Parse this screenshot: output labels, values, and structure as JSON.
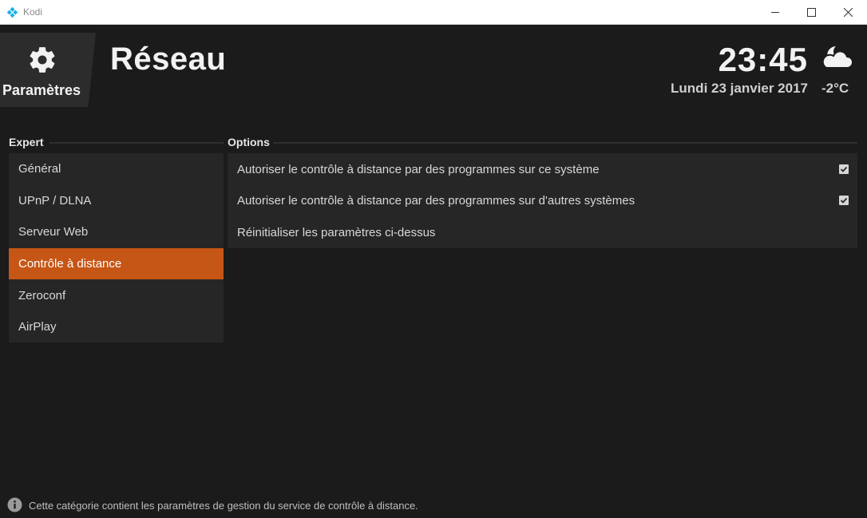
{
  "window": {
    "title": "Kodi",
    "minimize_icon": "minimize-icon",
    "maximize_icon": "maximize-icon",
    "close_icon": "close-icon"
  },
  "header": {
    "section_label": "Paramètres",
    "section_icon": "gear-icon",
    "title": "Réseau",
    "clock": "23:45",
    "date": "Lundi 23 janvier 2017",
    "temperature": "-2°C",
    "weather_icon": "partly-cloudy-night-icon"
  },
  "sidebar": {
    "heading": "Expert",
    "items": [
      {
        "label": "Général",
        "active": false
      },
      {
        "label": "UPnP / DLNA",
        "active": false
      },
      {
        "label": "Serveur Web",
        "active": false
      },
      {
        "label": "Contrôle à distance",
        "active": true
      },
      {
        "label": "Zeroconf",
        "active": false
      },
      {
        "label": "AirPlay",
        "active": false
      }
    ]
  },
  "options": {
    "heading": "Options",
    "rows": [
      {
        "label": "Autoriser le contrôle à distance par des programmes sur ce système",
        "checked": true
      },
      {
        "label": "Autoriser le contrôle à distance par des programmes sur d'autres systèmes",
        "checked": true
      },
      {
        "label": "Réinitialiser les paramètres ci-dessus"
      }
    ]
  },
  "footer": {
    "info_icon": "info-icon",
    "text": "Cette catégorie contient les paramètres de gestion du service de contrôle à distance."
  },
  "colors": {
    "accent": "#c65616",
    "background": "#1b1b1b",
    "panel": "#262626"
  }
}
